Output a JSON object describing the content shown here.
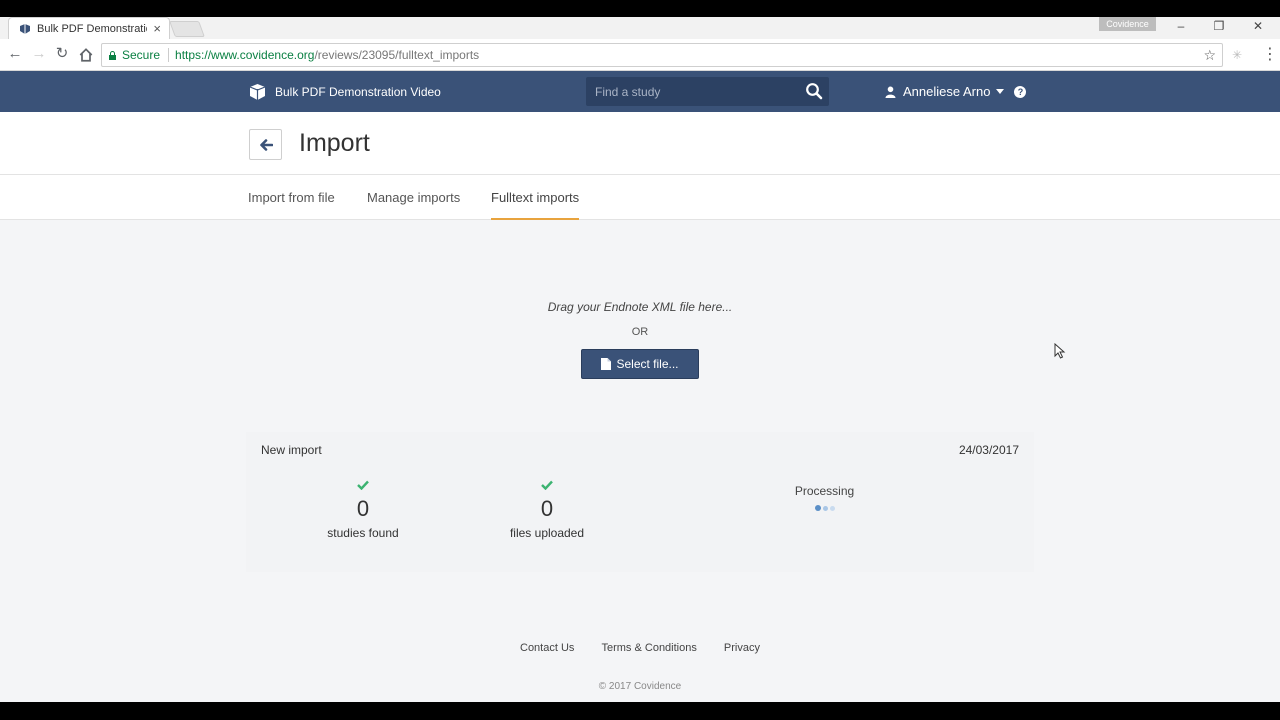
{
  "browser": {
    "tab_title": "Bulk PDF Demonstration",
    "tab_close": "×",
    "profile_chip": "Covidence",
    "window_minimize": "–",
    "window_restore": "❐",
    "window_close": "✕",
    "secure_label": "Secure",
    "url_host": "https://www.covidence.org",
    "url_path": "/reviews/23095/fulltext_imports"
  },
  "header": {
    "brand_title": "Bulk PDF Demonstration Video",
    "search_placeholder": "Find a study",
    "user_name": "Anneliese Arno",
    "help_label": "?"
  },
  "page": {
    "title": "Import"
  },
  "tabs": [
    {
      "label": "Import from file"
    },
    {
      "label": "Manage imports"
    },
    {
      "label": "Fulltext imports"
    }
  ],
  "upload": {
    "drop_hint": "Drag your Endnote XML file here...",
    "or_label": "OR",
    "select_button": "Select file..."
  },
  "import_card": {
    "title": "New import",
    "date": "24/03/2017",
    "stats": [
      {
        "value": "0",
        "label": "studies found"
      },
      {
        "value": "0",
        "label": "files uploaded"
      }
    ],
    "status": "Processing"
  },
  "footer": {
    "links": [
      "Contact Us",
      "Terms & Conditions",
      "Privacy"
    ],
    "copyright": "© 2017 Covidence"
  },
  "colors": {
    "header_bg": "#3a5278",
    "accent_tab": "#e8a33d",
    "check_green": "#3cb371",
    "secure_green": "#0b8043"
  }
}
